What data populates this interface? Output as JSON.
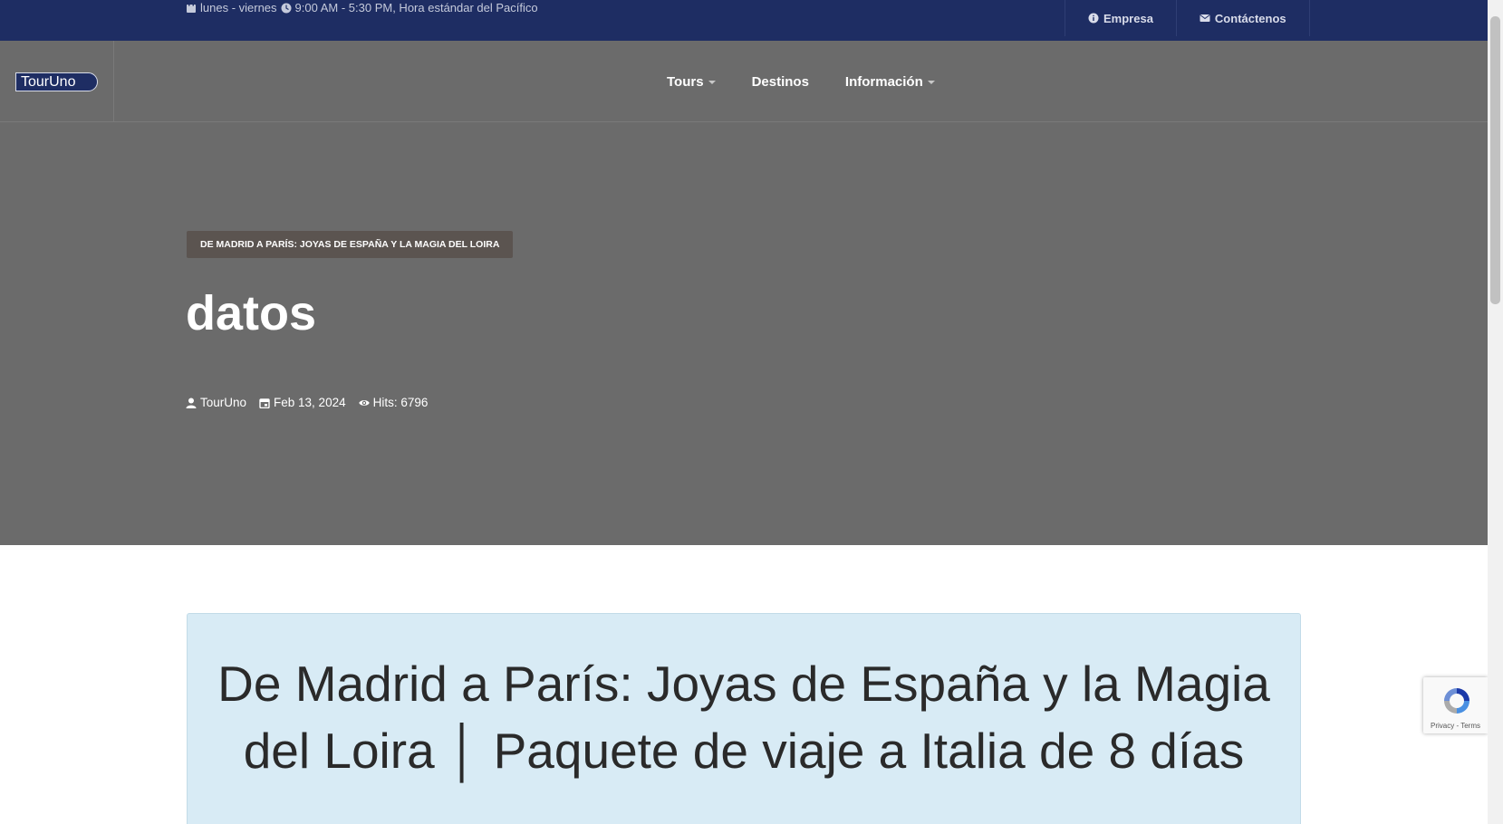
{
  "topbar": {
    "hours_text": "lunes - viernes",
    "time_text": "9:00 AM - 5:30 PM, Hora estándar del Pacífico",
    "links": [
      {
        "label": "Empresa",
        "icon": "info-icon"
      },
      {
        "label": "Contáctenos",
        "icon": "envelope-icon"
      }
    ]
  },
  "brand": {
    "logo_text": "TourUno"
  },
  "nav": {
    "items": [
      {
        "label": "Tours",
        "has_dropdown": true
      },
      {
        "label": "Destinos",
        "has_dropdown": false
      },
      {
        "label": "Información",
        "has_dropdown": true
      }
    ]
  },
  "hero": {
    "category_badge": "DE MADRID A PARÍS: JOYAS DE ESPAÑA Y LA MAGIA DEL LOIRA",
    "title": "datos",
    "meta": {
      "author": "TourUno",
      "date": "Feb 13, 2024",
      "hits": "Hits: 6796"
    }
  },
  "content": {
    "heading": "De Madrid a París: Joyas de España y la Magia del Loira │ Paquete de viaje a Italia de 8 días"
  },
  "recaptcha": {
    "links_text": "Privacy - Terms"
  },
  "colors": {
    "topbar_bg": "#1e2d63",
    "hero_bg": "#6b6b6b",
    "badge_bg": "#5b5450",
    "content_box_bg": "#d8ebf5"
  }
}
